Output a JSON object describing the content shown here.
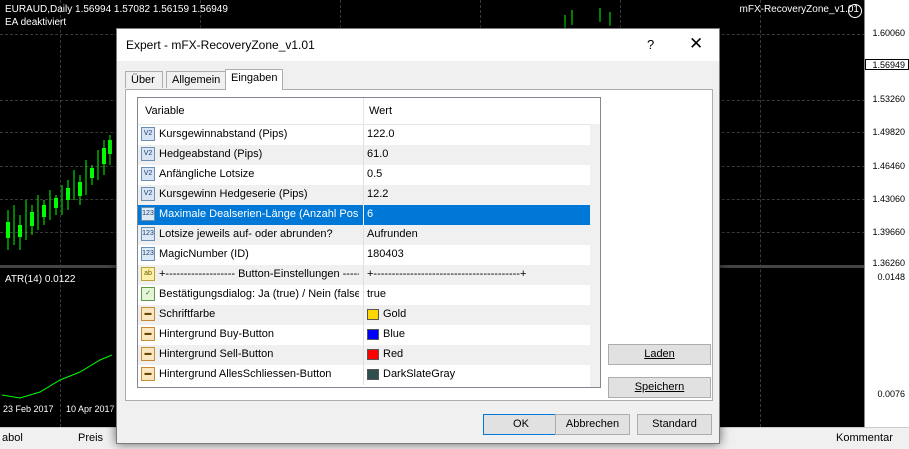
{
  "chart": {
    "symbol": "EURAUD,Daily  1.56994 1.57082 1.56159 1.56949",
    "ea_status": "EA deaktiviert",
    "ea_name": "mFX-RecoveryZone_v1.01",
    "price_levels": [
      "1.60060",
      "1.56949",
      "1.53260",
      "1.49820",
      "1.46460",
      "1.43060",
      "1.39660",
      "1.36260"
    ],
    "current_price": "1.56949",
    "atr_label": "ATR(14) 0.0122",
    "atr_levels": [
      "0.0148",
      "0.0076"
    ],
    "dates": [
      "23 Feb 2017",
      "10 Apr 2017"
    ]
  },
  "statusbar": {
    "left": "abol",
    "price": "Preis",
    "right": "Kommentar"
  },
  "dialog": {
    "title": "Expert - mFX-RecoveryZone_v1.01",
    "help": "?",
    "close": "✕",
    "tabs": [
      "Über",
      "Allgemein",
      "Eingaben"
    ],
    "grid_header": {
      "variable": "Variable",
      "value": "Wert"
    },
    "rows": [
      {
        "icon": "V2",
        "type": "num",
        "name": "Kursgewinnabstand (Pips)",
        "value": "122.0"
      },
      {
        "icon": "V2",
        "type": "num",
        "name": "Hedgeabstand (Pips)",
        "value": "61.0"
      },
      {
        "icon": "V2",
        "type": "num",
        "name": "Anfängliche Lotsize",
        "value": "0.5"
      },
      {
        "icon": "V2",
        "type": "num",
        "name": "Kursgewinn Hedgeserie (Pips)",
        "value": "12.2"
      },
      {
        "icon": "123",
        "type": "int",
        "name": "Maximale Dealserien-Länge (Anzahl Posi...",
        "value": "6"
      },
      {
        "icon": "123",
        "type": "int",
        "name": "Lotsize jeweils auf- oder abrunden?",
        "value": "Aufrunden"
      },
      {
        "icon": "123",
        "type": "int",
        "name": "MagicNumber (ID)",
        "value": "180403"
      },
      {
        "icon": "ab",
        "type": "str",
        "name": "+------------------- Button-Einstellungen ---------------...",
        "value": "+----------------------------------------+"
      },
      {
        "icon": "✓",
        "type": "bool",
        "name": "Bestätigungsdialog: Ja (true) / Nein (false)",
        "value": "true"
      },
      {
        "icon": "▬",
        "type": "color",
        "name": "Schriftfarbe",
        "value": "Gold",
        "swatch": "#ffd700"
      },
      {
        "icon": "▬",
        "type": "color",
        "name": "Hintergrund Buy-Button",
        "value": "Blue",
        "swatch": "#0000ff"
      },
      {
        "icon": "▬",
        "type": "color",
        "name": "Hintergrund Sell-Button",
        "value": "Red",
        "swatch": "#ff0000"
      },
      {
        "icon": "▬",
        "type": "color",
        "name": "Hintergrund AllesSchliessen-Button",
        "value": "DarkSlateGray",
        "swatch": "#2f4f4f"
      }
    ],
    "buttons": {
      "load": "Laden",
      "save": "Speichern",
      "ok": "OK",
      "cancel": "Abbrechen",
      "standard": "Standard"
    }
  }
}
